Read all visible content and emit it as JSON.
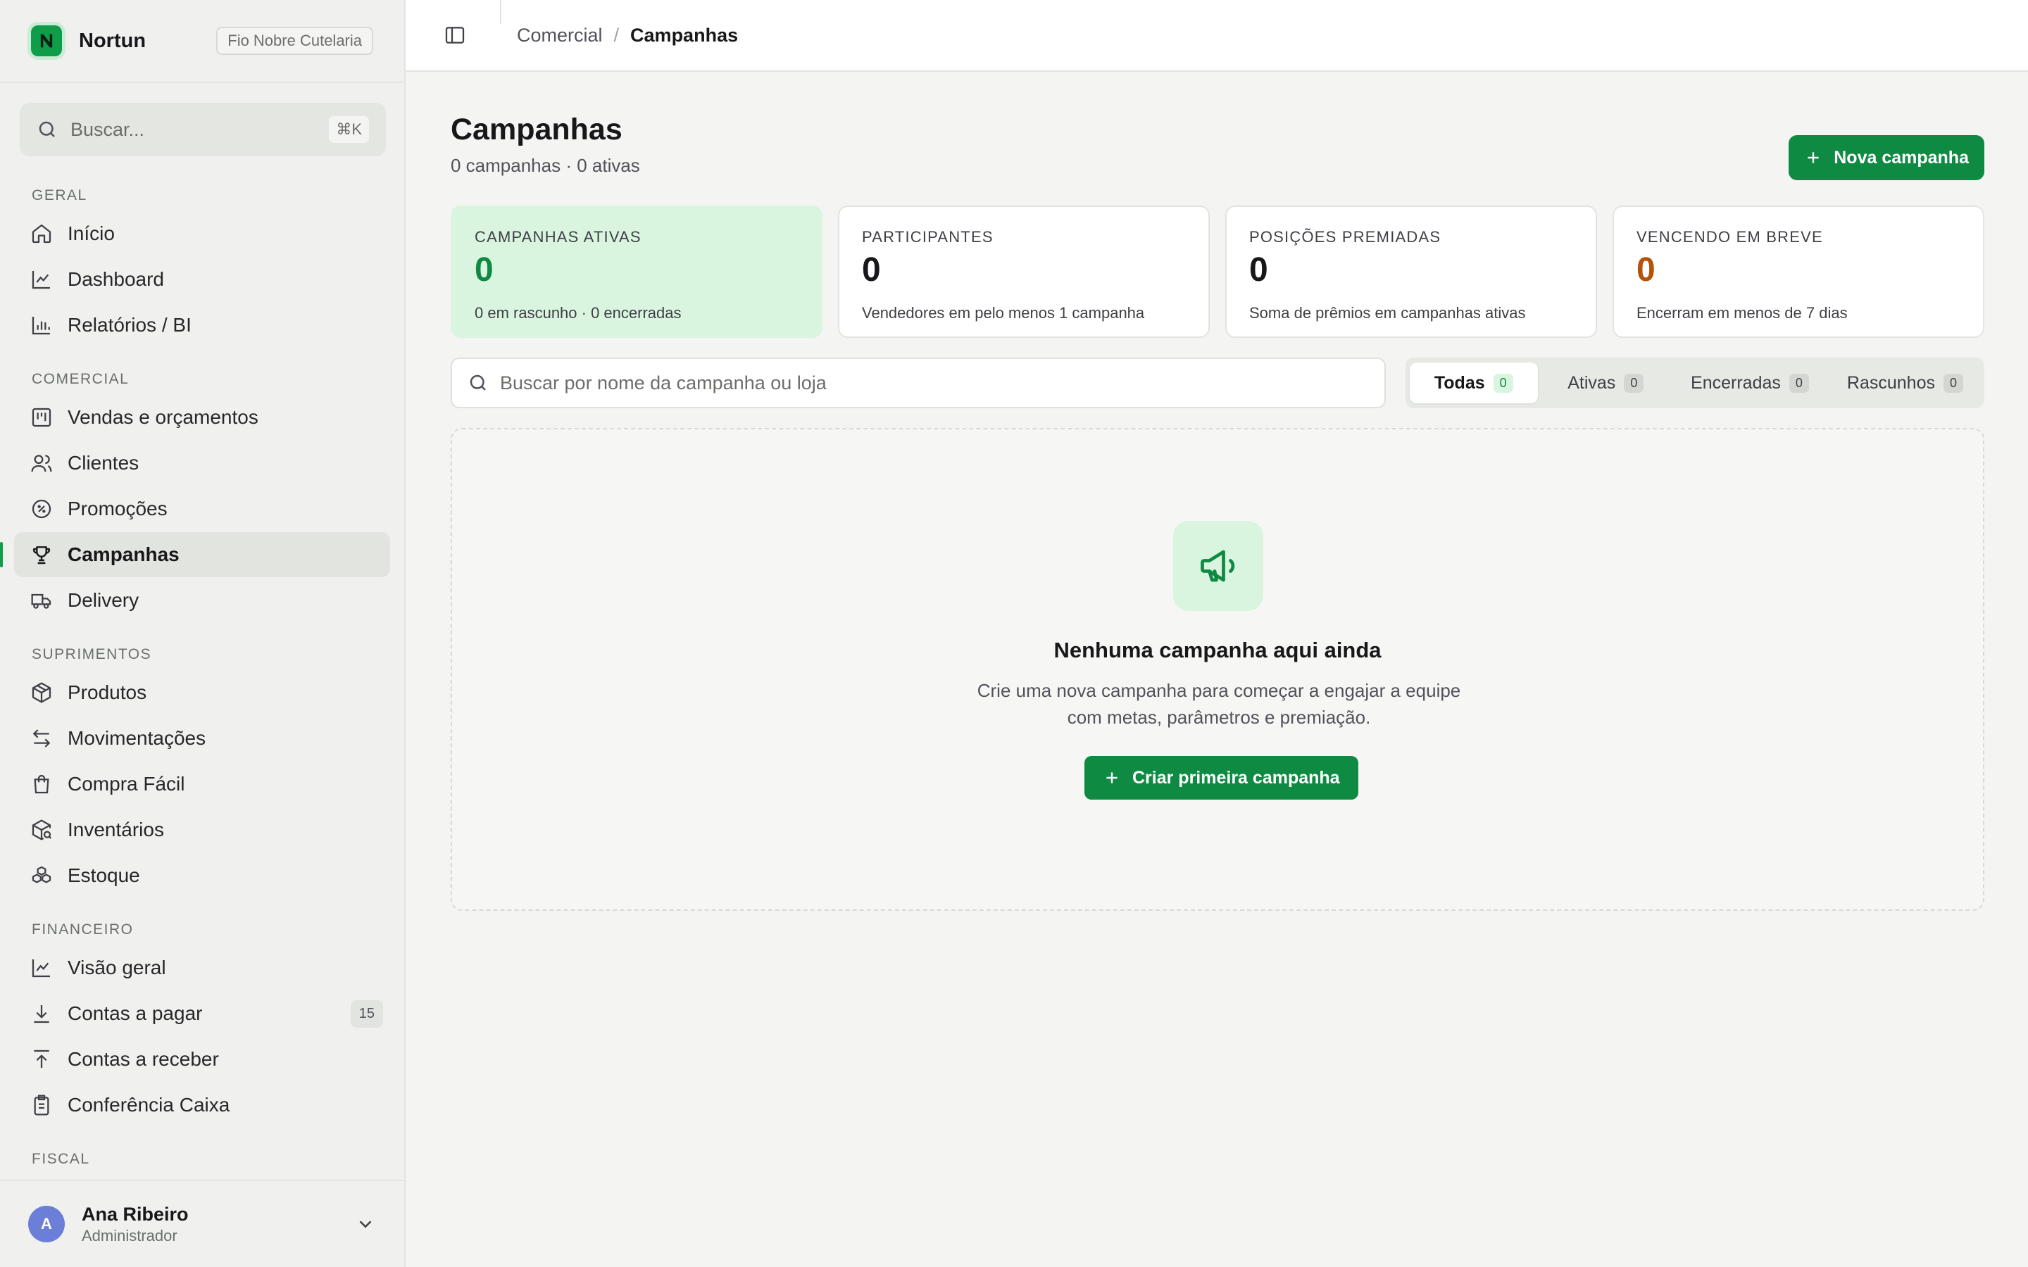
{
  "brand": {
    "name": "Nortun",
    "tenant": "Fio Nobre Cutelaria",
    "accent": "#0f9d4a"
  },
  "search": {
    "placeholder": "Buscar...",
    "shortcut": "⌘K"
  },
  "nav": {
    "sections": [
      {
        "label": "GERAL",
        "items": [
          {
            "label": "Início",
            "icon": "home-icon"
          },
          {
            "label": "Dashboard",
            "icon": "line-chart-icon"
          },
          {
            "label": "Relatórios / BI",
            "icon": "bar-chart-icon"
          }
        ]
      },
      {
        "label": "COMERCIAL",
        "items": [
          {
            "label": "Vendas e orçamentos",
            "icon": "kanban-icon"
          },
          {
            "label": "Clientes",
            "icon": "users-icon"
          },
          {
            "label": "Promoções",
            "icon": "percent-badge-icon"
          },
          {
            "label": "Campanhas",
            "icon": "trophy-icon",
            "active": true
          },
          {
            "label": "Delivery",
            "icon": "truck-icon"
          }
        ]
      },
      {
        "label": "SUPRIMENTOS",
        "items": [
          {
            "label": "Produtos",
            "icon": "package-icon"
          },
          {
            "label": "Movimentações",
            "icon": "arrows-left-right-icon"
          },
          {
            "label": "Compra Fácil",
            "icon": "shopping-bag-icon"
          },
          {
            "label": "Inventários",
            "icon": "package-search-icon"
          },
          {
            "label": "Estoque",
            "icon": "boxes-icon"
          }
        ]
      },
      {
        "label": "FINANCEIRO",
        "items": [
          {
            "label": "Visão geral",
            "icon": "line-chart-icon"
          },
          {
            "label": "Contas a pagar",
            "icon": "download-icon",
            "badge": "15"
          },
          {
            "label": "Contas a receber",
            "icon": "upload-icon"
          },
          {
            "label": "Conferência Caixa",
            "icon": "clipboard-icon"
          }
        ]
      },
      {
        "label": "FISCAL",
        "items": []
      }
    ]
  },
  "user": {
    "initial": "A",
    "name": "Ana Ribeiro",
    "role": "Administrador"
  },
  "breadcrumb": {
    "parent": "Comercial",
    "separator": "/",
    "current": "Campanhas"
  },
  "page": {
    "title": "Campanhas",
    "subtitle": "0 campanhas · 0 ativas",
    "new_button": "Nova campanha"
  },
  "stats": [
    {
      "label": "CAMPANHAS ATIVAS",
      "value": "0",
      "desc": "0 em rascunho · 0 encerradas",
      "color": "#0f8a43"
    },
    {
      "label": "PARTICIPANTES",
      "value": "0",
      "desc": "Vendedores em pelo menos 1 campanha",
      "color": "#18181b"
    },
    {
      "label": "POSIÇÕES PREMIADAS",
      "value": "0",
      "desc": "Soma de prêmios em campanhas ativas",
      "color": "#18181b"
    },
    {
      "label": "VENCENDO EM BREVE",
      "value": "0",
      "desc": "Encerram em menos de 7 dias",
      "color": "#b45309"
    }
  ],
  "filter": {
    "placeholder": "Buscar por nome da campanha ou loja",
    "tabs": [
      {
        "label": "Todas",
        "count": "0",
        "active": true
      },
      {
        "label": "Ativas",
        "count": "0"
      },
      {
        "label": "Encerradas",
        "count": "0"
      },
      {
        "label": "Rascunhos",
        "count": "0"
      }
    ]
  },
  "empty": {
    "icon": "megaphone-icon",
    "title": "Nenhuma campanha aqui ainda",
    "description": "Crie uma nova campanha para começar a engajar a equipe com metas, parâmetros e premiação.",
    "button": "Criar primeira campanha"
  }
}
